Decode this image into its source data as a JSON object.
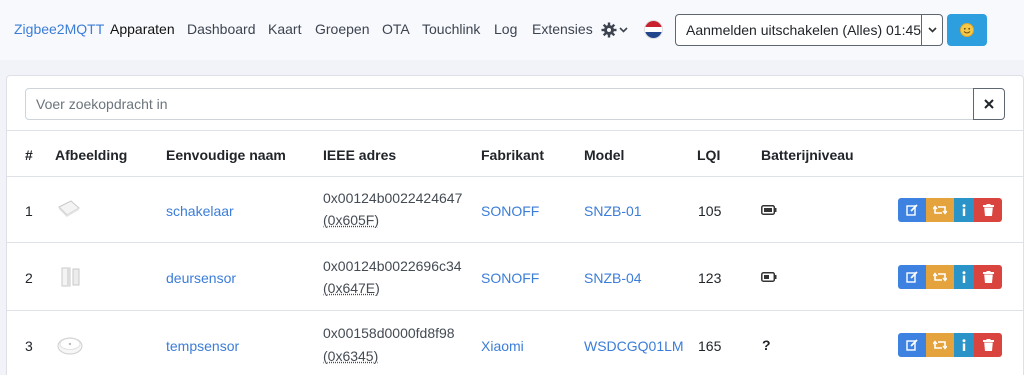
{
  "nav": {
    "brand": "Zigbee2MQTT",
    "links": [
      "Apparaten",
      "Dashboard",
      "Kaart",
      "Groepen",
      "OTA",
      "Touchlink",
      "Log",
      "Extensies"
    ],
    "settings_icon": "gear-icon",
    "language_flag": "netherlands-flag-icon",
    "permit_join_label": "Aanmelden uitschakelen (Alles) 01:45",
    "theme_icon": "sun-face-icon"
  },
  "search": {
    "placeholder": "Voer zoekopdracht in",
    "value": "",
    "clear_icon": "close-icon"
  },
  "table": {
    "headers": [
      "#",
      "Afbeelding",
      "Eenvoudige naam",
      "IEEE adres",
      "Fabrikant",
      "Model",
      "LQI",
      "Batterijniveau"
    ],
    "rows": [
      {
        "index": "1",
        "name": "schakelaar",
        "ieee": "0x00124b0022424647",
        "nwk": "(0x605F)",
        "vendor": "SONOFF",
        "model": "SNZB-01",
        "lqi": "105",
        "battery": "battery-icon"
      },
      {
        "index": "2",
        "name": "deursensor",
        "ieee": "0x00124b0022696c34",
        "nwk": "(0x647E)",
        "vendor": "SONOFF",
        "model": "SNZB-04",
        "lqi": "123",
        "battery": "battery-icon"
      },
      {
        "index": "3",
        "name": "tempsensor",
        "ieee": "0x00158d0000fd8f98",
        "nwk": "(0x6345)",
        "vendor": "Xiaomi",
        "model": "WSDCGQ01LM",
        "lqi": "165",
        "battery": "?"
      }
    ]
  },
  "colors": {
    "link": "#3b7dd8",
    "edit": "#3d82e0",
    "configure": "#e4a33d",
    "info": "#2a93c8",
    "delete": "#d9443f",
    "theme_button": "#2d9fde"
  }
}
